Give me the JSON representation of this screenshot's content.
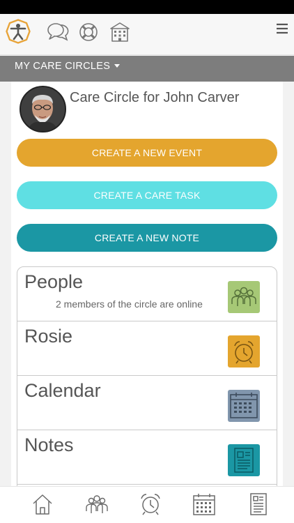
{
  "header": {
    "logo_icon": "accessibility-figure-icon",
    "icons": [
      "chat-bubbles-icon",
      "life-ring-icon",
      "building-icon",
      "hamburger-menu-icon"
    ]
  },
  "circles_menu": {
    "label": "MY CARE CIRCLES"
  },
  "circle": {
    "title": "Care Circle for John Carver"
  },
  "actions": {
    "new_event": "CREATE A NEW EVENT",
    "care_task": "CREATE A CARE TASK",
    "new_note": "CREATE A NEW NOTE"
  },
  "cards": [
    {
      "title": "People",
      "subtitle": "2 members of the circle are online",
      "icon": "people-icon",
      "color": "#a6c876"
    },
    {
      "title": "Rosie",
      "subtitle": "",
      "icon": "alarm-clock-icon",
      "color": "#e4a52e"
    },
    {
      "title": "Calendar",
      "subtitle": "",
      "icon": "calendar-icon",
      "color": "#8196ad"
    },
    {
      "title": "Notes",
      "subtitle": "",
      "icon": "notes-icon",
      "color": "#1b97a4"
    }
  ],
  "bottom_nav": [
    "home-icon",
    "people-icon",
    "alarm-clock-icon",
    "calendar-icon",
    "document-icon"
  ],
  "colors": {
    "event": "#e4a52e",
    "task": "#5fdfe3",
    "note": "#1b97a4",
    "circles_bar": "#7d7d7d"
  }
}
